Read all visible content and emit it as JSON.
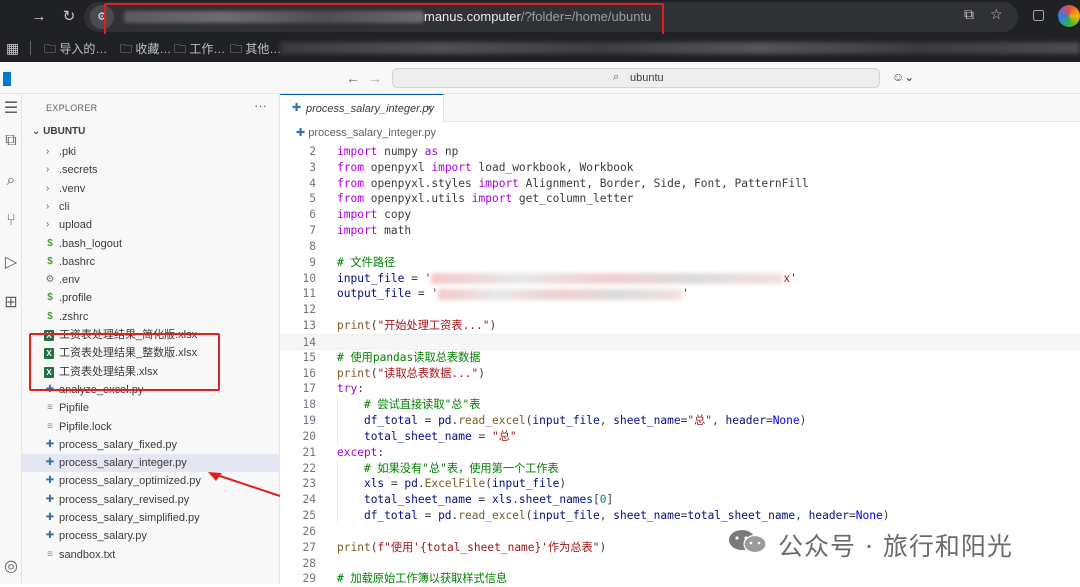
{
  "browser": {
    "url_domain": "manus.computer",
    "url_path": "/?folder=/home/ubuntu",
    "bookmarks": [
      "导入的…",
      "收藏…",
      "工作…",
      "其他…"
    ]
  },
  "titlebar": {
    "search_text": "ubuntu"
  },
  "explorer": {
    "header": "EXPLORER",
    "more": "···",
    "root": "UBUNTU",
    "items": [
      {
        "label": ".pki",
        "kind": "folder"
      },
      {
        "label": ".secrets",
        "kind": "folder"
      },
      {
        "label": ".venv",
        "kind": "folder"
      },
      {
        "label": "cli",
        "kind": "folder"
      },
      {
        "label": "upload",
        "kind": "folder"
      },
      {
        "label": ".bash_logout",
        "kind": "shell"
      },
      {
        "label": ".bashrc",
        "kind": "shell"
      },
      {
        "label": ".env",
        "kind": "gear"
      },
      {
        "label": ".profile",
        "kind": "shell"
      },
      {
        "label": ".zshrc",
        "kind": "shell"
      },
      {
        "label": "工资表处理结果_简化版.xlsx",
        "kind": "xlsx"
      },
      {
        "label": "工资表处理结果_整数版.xlsx",
        "kind": "xlsx"
      },
      {
        "label": "工资表处理结果.xlsx",
        "kind": "xlsx"
      },
      {
        "label": "analyze_excel.py",
        "kind": "py"
      },
      {
        "label": "Pipfile",
        "kind": "file"
      },
      {
        "label": "Pipfile.lock",
        "kind": "file"
      },
      {
        "label": "process_salary_fixed.py",
        "kind": "py"
      },
      {
        "label": "process_salary_integer.py",
        "kind": "py",
        "selected": true
      },
      {
        "label": "process_salary_optimized.py",
        "kind": "py"
      },
      {
        "label": "process_salary_revised.py",
        "kind": "py"
      },
      {
        "label": "process_salary_simplified.py",
        "kind": "py"
      },
      {
        "label": "process_salary.py",
        "kind": "py"
      },
      {
        "label": "sandbox.txt",
        "kind": "file"
      }
    ]
  },
  "editor": {
    "tab_label": "process_salary_integer.py",
    "tab_close": "×",
    "breadcrumb": "process_salary_integer.py",
    "lines": [
      {
        "n": "2"
      },
      {
        "n": "3"
      },
      {
        "n": "4"
      },
      {
        "n": "5"
      },
      {
        "n": "6"
      },
      {
        "n": "7"
      },
      {
        "n": "8"
      },
      {
        "n": "9"
      },
      {
        "n": "10"
      },
      {
        "n": "11"
      },
      {
        "n": "12"
      },
      {
        "n": "13"
      },
      {
        "n": "14"
      },
      {
        "n": "15"
      },
      {
        "n": "16"
      },
      {
        "n": "17"
      },
      {
        "n": "18"
      },
      {
        "n": "19"
      },
      {
        "n": "20"
      },
      {
        "n": "21"
      },
      {
        "n": "22"
      },
      {
        "n": "23"
      },
      {
        "n": "24"
      },
      {
        "n": "25"
      },
      {
        "n": "26"
      },
      {
        "n": "27"
      },
      {
        "n": "28"
      },
      {
        "n": "29"
      }
    ],
    "code": {
      "import": "import",
      "from": "from",
      "as": "as",
      "try": "try",
      "except": "except",
      "l2_mod": "numpy",
      "l2_alias": "np",
      "l3_mod": "openpyxl",
      "l3_names": "load_workbook, Workbook",
      "l4_mod": "openpyxl.styles",
      "l4_names": "Alignment, Border, Side, Font, PatternFill",
      "l5_mod": "openpyxl.utils",
      "l5_names": "get_column_letter",
      "l6_mod": "copy",
      "l7_mod": "math",
      "l9_comment": "# 文件路径",
      "l10_var": "input_file",
      "l11_var": "output_file",
      "print": "print",
      "l13_str": "\"开始处理工资表...\"",
      "l15_comment": "# 使用pandas读取总表数据",
      "l16_str": "\"读取总表数据...\"",
      "l18_comment": "# 尝试直接读取\"总\"表",
      "df_total": "df_total",
      "pd": "pd",
      "read_excel": "read_excel",
      "input_file": "input_file",
      "sheet_name": "sheet_name",
      "header": "header",
      "none": "None",
      "l19_sheet": "\"总\"",
      "total_sheet_name": "total_sheet_name",
      "l22_comment": "# 如果没有\"总\"表，使用第一个工作表",
      "xls": "xls",
      "excelfile": "ExcelFile",
      "sheet_names": "sheet_names",
      "zero": "0",
      "l27_str": "f\"使用'{total_sheet_name}'作为总表\"",
      "l29_comment": "# 加载原始工作簿以获取样式信息",
      "l10_tail": "x'",
      "l11_tail": "'"
    }
  },
  "watermark": {
    "text": "公众号 · 旅行和阳光"
  },
  "colors": {
    "highlight_red": "#e02020",
    "keyword_purple": "#af00db",
    "string_red": "#a31515",
    "comment_green": "#008000"
  }
}
